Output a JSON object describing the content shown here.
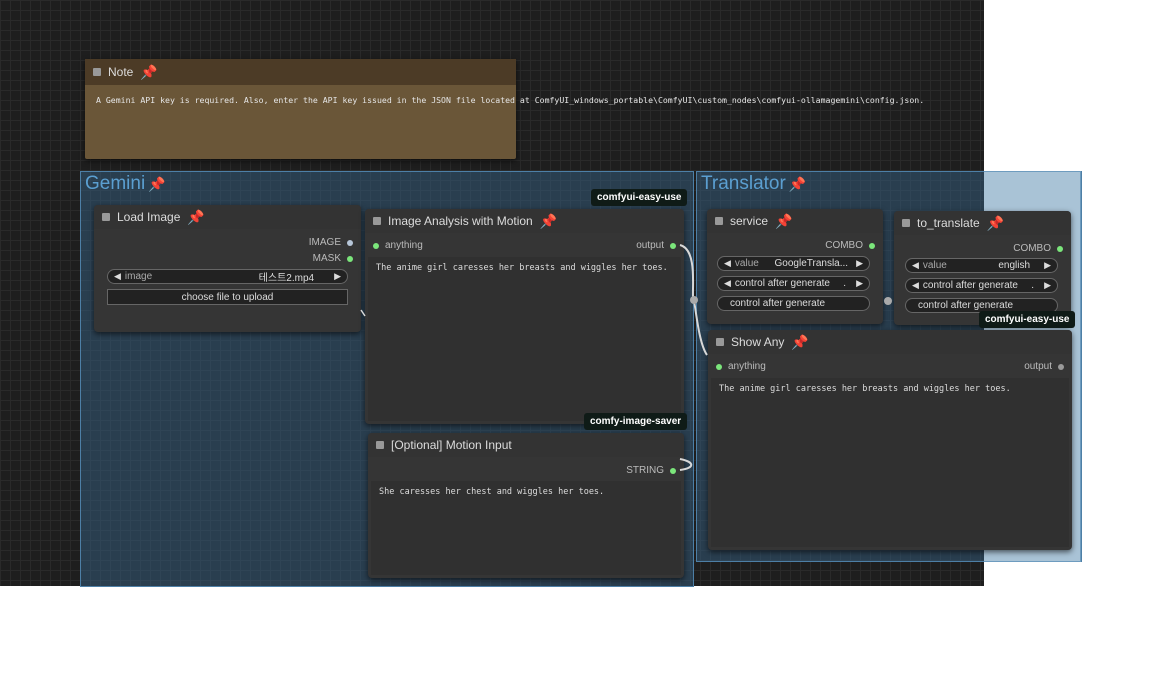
{
  "note": {
    "title": "Note",
    "text": "A Gemini API key is required. Also, enter the API key issued in the JSON file located at ComfyUI_windows_portable\\ComfyUI\\custom_nodes\\comfyui-ollamagemini\\config.json."
  },
  "groups": {
    "gemini": "Gemini",
    "translator": "Translator"
  },
  "load_image": {
    "title": "Load Image",
    "out_image": "IMAGE",
    "out_mask": "MASK",
    "widget_label": "image",
    "widget_value": "테스트2.mp4",
    "upload_button": "choose file to upload"
  },
  "analysis": {
    "title": "Image Analysis with Motion",
    "badge": "comfyui-easy-use",
    "input": "anything",
    "output": "output",
    "text": "The anime girl caresses her breasts and wiggles her toes."
  },
  "motion": {
    "title": "[Optional] Motion Input",
    "badge": "comfy-image-saver",
    "output": "STRING",
    "text": "She caresses her chest and wiggles her toes."
  },
  "service": {
    "title": "service",
    "output": "COMBO",
    "value_label": "value",
    "value": "GoogleTransla...",
    "control_label": "control after generate",
    "control_value": ".",
    "control2": "control after generate"
  },
  "to_translate": {
    "title": "to_translate",
    "output": "COMBO",
    "value_label": "value",
    "value": "english",
    "control_label": "control after generate",
    "control_value": ".",
    "control2": "control after generate",
    "badge": "comfyui-easy-use"
  },
  "show_any": {
    "title": "Show Any",
    "input": "anything",
    "output": "output",
    "text": "The anime girl caresses her breasts and wiggles her toes."
  },
  "colors": {
    "canvas": "#1e1e1e",
    "group_border": "#4d7fa6",
    "group_title": "#5b9fd1",
    "note_body": "#6a5638",
    "slot_connected": "#7be67b"
  }
}
